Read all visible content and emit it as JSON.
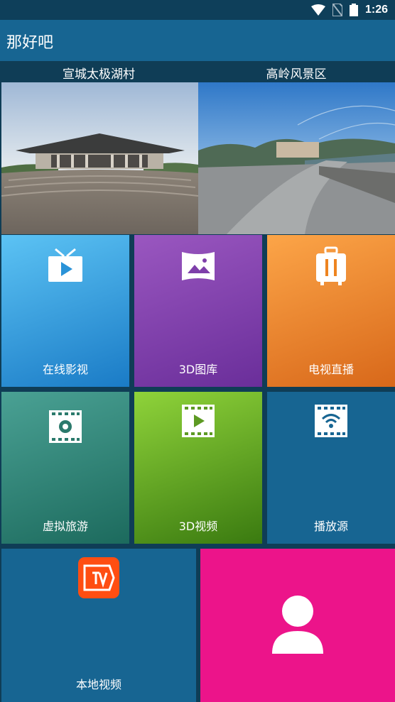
{
  "status": {
    "time": "1:26"
  },
  "app": {
    "title": "那好吧"
  },
  "banners": [
    {
      "title": "宣城太极湖村"
    },
    {
      "title": "高岭风景区"
    }
  ],
  "tiles": [
    {
      "label": "在线影视",
      "icon": "tv-play-icon",
      "color": "#2a93d8"
    },
    {
      "label": "3D图库",
      "icon": "panorama-icon",
      "color": "#7e3faa"
    },
    {
      "label": "电视直播",
      "icon": "suitcase-icon",
      "color": "#ee8420"
    },
    {
      "label": "虚拟旅游",
      "icon": "film-globe-icon",
      "color": "#2b7a6c"
    },
    {
      "label": "3D视频",
      "icon": "film-play-icon",
      "color": "#5d9a23"
    },
    {
      "label": "播放源",
      "icon": "film-wifi-icon",
      "color": "#176592"
    },
    {
      "label": "本地视频",
      "icon": "tv-logo-icon",
      "color": "#176592"
    },
    {
      "label": "",
      "icon": "user-icon",
      "color": "#ec148a"
    }
  ]
}
